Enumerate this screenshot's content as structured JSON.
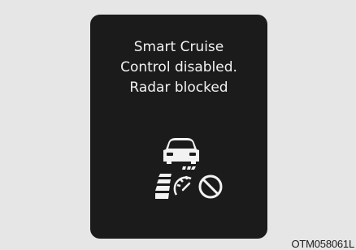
{
  "display": {
    "message_lines": [
      "Smart Cruise",
      "Control disabled.",
      "Radar blocked"
    ],
    "icon": "smart-cruise-radar-blocked-icon"
  },
  "figure_code": "OTM058061L",
  "colors": {
    "background": "#e6e6e6",
    "panel": "#1b1b1b",
    "text": "#f2f2f2"
  }
}
